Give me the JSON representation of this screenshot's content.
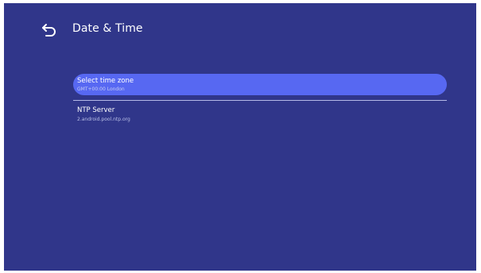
{
  "header": {
    "title": "Date & Time",
    "back_icon": "back-arrow-icon"
  },
  "settings": {
    "items": [
      {
        "label": "Select time zone",
        "value": "GMT+00:00  London",
        "selected": true
      },
      {
        "label": "NTP Server",
        "value": "2.android.pool.ntp.org",
        "selected": false
      }
    ]
  },
  "colors": {
    "background": "#30368a",
    "highlight": "#5768f2",
    "text": "#ffffff"
  }
}
